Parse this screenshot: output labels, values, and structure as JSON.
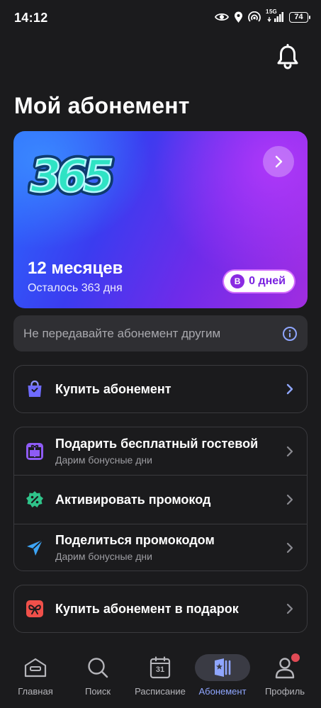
{
  "status": {
    "time": "14:12",
    "network": "5G",
    "sim": "1",
    "battery": "74"
  },
  "page": {
    "title": "Мой абонемент"
  },
  "card": {
    "logo_text": "365",
    "title": "12 месяцев",
    "subtitle": "Осталось 363 дня",
    "days_badge": "B",
    "days_label": "0 дней"
  },
  "notice": {
    "text": "Не передавайте абонемент другим"
  },
  "menu": {
    "buy": {
      "label": "Купить абонемент"
    },
    "gift_guest": {
      "label": "Подарить бесплатный гостевой",
      "sub": "Дарим бонусные дни"
    },
    "promo_activate": {
      "label": "Активировать промокод"
    },
    "promo_share": {
      "label": "Поделиться промокодом",
      "sub": "Дарим бонусные дни"
    },
    "gift_buy": {
      "label": "Купить абонемент в подарок"
    }
  },
  "tabs": [
    {
      "label": "Главная",
      "icon": "home-icon"
    },
    {
      "label": "Поиск",
      "icon": "search-icon"
    },
    {
      "label": "Расписание",
      "icon": "calendar-icon",
      "calendar_day": "31"
    },
    {
      "label": "Абонемент",
      "icon": "membership-icon",
      "active": true
    },
    {
      "label": "Профиль",
      "icon": "profile-icon",
      "has_notification": true
    }
  ],
  "colors": {
    "background": "#1b1b1d",
    "accent": "#8fa6ff",
    "card_gradient_start": "#2a6bff",
    "card_gradient_end": "#a12de0",
    "days_text": "#7a22e0",
    "notification": "#e14a55"
  }
}
